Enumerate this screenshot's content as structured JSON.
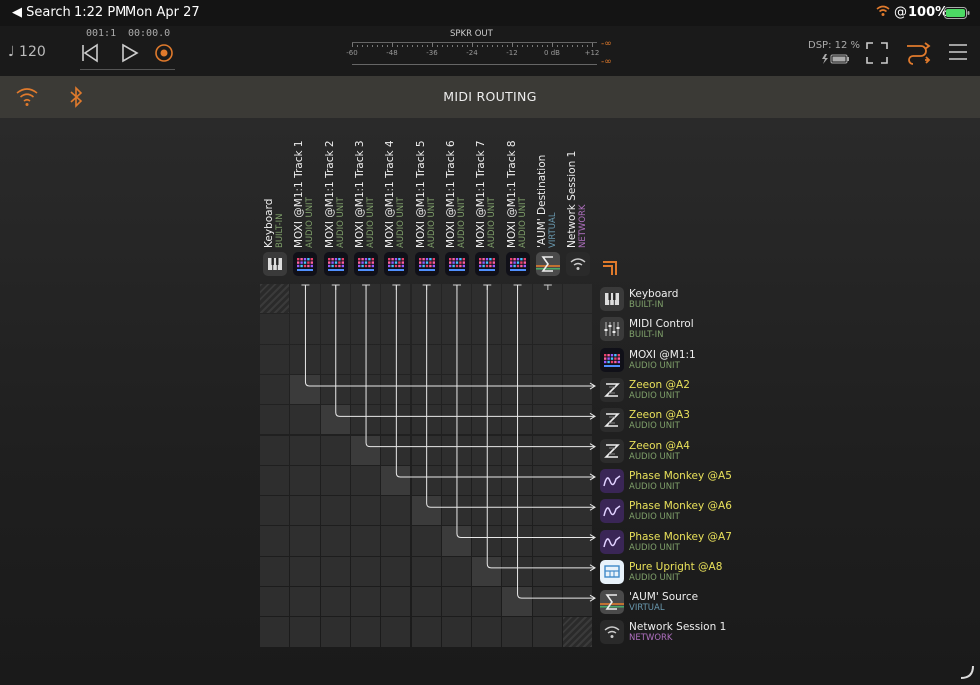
{
  "status": {
    "back_label": "◀ Search",
    "time": "1:22 PM",
    "date": "Mon Apr 27",
    "battery": "100%"
  },
  "transport": {
    "tempo": "♩ 120",
    "position_bars": "001:1",
    "position_time": "00:00.0",
    "meter_title": "SPKR OUT",
    "meter_ticks": [
      "-60",
      "-48",
      "-36",
      "-24",
      "-12",
      "0 dB",
      "+12"
    ],
    "meter_inf_top": "-∞",
    "meter_inf_bottom": "-∞",
    "dsp_label": "DSP: 12 %"
  },
  "tabbar": {
    "title": "MIDI ROUTING"
  },
  "sources": [
    {
      "name": "Keyboard",
      "sub": "BUILT-IN",
      "sub_color": "#7fa06a",
      "icon": "piano-keys-icon"
    },
    {
      "name": "MOXI @M1:1 Track 1",
      "sub": "AUDIO UNIT",
      "sub_color": "#7fa06a",
      "icon": "moxi-icon"
    },
    {
      "name": "MOXI @M1:1 Track 2",
      "sub": "AUDIO UNIT",
      "sub_color": "#7fa06a",
      "icon": "moxi-icon"
    },
    {
      "name": "MOXI @M1:1 Track 3",
      "sub": "AUDIO UNIT",
      "sub_color": "#7fa06a",
      "icon": "moxi-icon"
    },
    {
      "name": "MOXI @M1:1 Track 4",
      "sub": "AUDIO UNIT",
      "sub_color": "#7fa06a",
      "icon": "moxi-icon"
    },
    {
      "name": "MOXI @M1:1 Track 5",
      "sub": "AUDIO UNIT",
      "sub_color": "#7fa06a",
      "icon": "moxi-icon"
    },
    {
      "name": "MOXI @M1:1 Track 6",
      "sub": "AUDIO UNIT",
      "sub_color": "#7fa06a",
      "icon": "moxi-icon"
    },
    {
      "name": "MOXI @M1:1 Track 7",
      "sub": "AUDIO UNIT",
      "sub_color": "#7fa06a",
      "icon": "moxi-icon"
    },
    {
      "name": "MOXI @M1:1 Track 8",
      "sub": "AUDIO UNIT",
      "sub_color": "#7fa06a",
      "icon": "moxi-icon"
    },
    {
      "name": "'AUM' Destination",
      "sub": "VIRTUAL",
      "sub_color": "#6a9ab0",
      "icon": "sigma-icon"
    },
    {
      "name": "Network Session 1",
      "sub": "NETWORK",
      "sub_color": "#b070c0",
      "icon": "wifi-icon"
    }
  ],
  "destinations": [
    {
      "name": "Keyboard",
      "sub": "BUILT-IN",
      "sub_color": "#7fa06a",
      "name_color": "#eeeeee",
      "icon": "piano-keys-icon"
    },
    {
      "name": "MIDI Control",
      "sub": "BUILT-IN",
      "sub_color": "#7fa06a",
      "name_color": "#eeeeee",
      "icon": "sliders-icon"
    },
    {
      "name": "MOXI @M1:1",
      "sub": "AUDIO UNIT",
      "sub_color": "#7fa06a",
      "name_color": "#eeeeee",
      "icon": "moxi-icon"
    },
    {
      "name": "Zeeon @A2",
      "sub": "AUDIO UNIT",
      "sub_color": "#7fa06a",
      "name_color": "#e8e05a",
      "icon": "zeeon-icon"
    },
    {
      "name": "Zeeon @A3",
      "sub": "AUDIO UNIT",
      "sub_color": "#7fa06a",
      "name_color": "#e8e05a",
      "icon": "zeeon-icon"
    },
    {
      "name": "Zeeon @A4",
      "sub": "AUDIO UNIT",
      "sub_color": "#7fa06a",
      "name_color": "#e8e05a",
      "icon": "zeeon-icon"
    },
    {
      "name": "Phase Monkey @A5",
      "sub": "AUDIO UNIT",
      "sub_color": "#7fa06a",
      "name_color": "#e8e05a",
      "icon": "phase-monkey-icon"
    },
    {
      "name": "Phase Monkey @A6",
      "sub": "AUDIO UNIT",
      "sub_color": "#7fa06a",
      "name_color": "#e8e05a",
      "icon": "phase-monkey-icon"
    },
    {
      "name": "Phase Monkey @A7",
      "sub": "AUDIO UNIT",
      "sub_color": "#7fa06a",
      "name_color": "#e8e05a",
      "icon": "phase-monkey-icon"
    },
    {
      "name": "Pure Upright @A8",
      "sub": "AUDIO UNIT",
      "sub_color": "#7fa06a",
      "name_color": "#e8e05a",
      "icon": "piano-icon"
    },
    {
      "name": "'AUM' Source",
      "sub": "VIRTUAL",
      "sub_color": "#6a9ab0",
      "name_color": "#eeeeee",
      "icon": "sigma-icon"
    },
    {
      "name": "Network Session 1",
      "sub": "NETWORK",
      "sub_color": "#b070c0",
      "name_color": "#eeeeee",
      "icon": "wifi-icon"
    }
  ],
  "connections": [
    [
      1,
      3
    ],
    [
      2,
      4
    ],
    [
      3,
      5
    ],
    [
      4,
      6
    ],
    [
      5,
      7
    ],
    [
      6,
      8
    ],
    [
      7,
      9
    ],
    [
      8,
      10
    ]
  ],
  "colors": {
    "accent": "#e07a2c",
    "grid_cell": "#2e2e2e",
    "grid_line": "#1b1b1b"
  }
}
